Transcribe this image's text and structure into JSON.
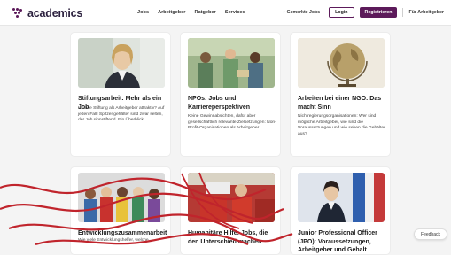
{
  "header": {
    "logo_text": "academics",
    "nav": [
      "Jobs",
      "Arbeitgeber",
      "Ratgeber",
      "Services"
    ],
    "saved_jobs": "Gemerkte Jobs",
    "login": "Login",
    "register": "Registrieren",
    "for_employers": "Für Arbeitgeber"
  },
  "cards": [
    {
      "title": "Stiftungsarbeit: Mehr als ein Job",
      "text": "Ist eine Stiftung als Arbeitgeber attraktiv? Auf jeden Fall! Spitzengehälter sind zwar selten, der Job sinnstiftend. Ein Überblick."
    },
    {
      "title": "NPOs: Jobs und Karriereperspektiven",
      "text": "Keine Gewinnabsichten, dafür aber gesellschaftlich relevante Zielsetzungen: Non-Profit-Organisationen als Arbeitgeber."
    },
    {
      "title": "Arbeiten bei einer NGO: Das macht Sinn",
      "text": "Nichtregierungsorganisationen: Wer sind mögliche Arbeitgeber, wie sind die Voraussetzungen und wie sehen die Gehälter aus?"
    },
    {
      "title": "Entwicklungs",
      "title_tail": "zusammenarbeit",
      "text": "Wie viele Entwicklungshelfer, welche"
    },
    {
      "title": "Humanit",
      "title_tail": "äre Hilfe: Jobs, die den Unterschied machen",
      "text": ""
    },
    {
      "title": "Junior Professional Officer (JPO): Voraussetzungen, Arbeitgeber und Gehalt",
      "text": ""
    }
  ],
  "feedback": "Feedback",
  "colors": {
    "brand": "#5c1a5a",
    "overlay_red": "#c0242c"
  }
}
